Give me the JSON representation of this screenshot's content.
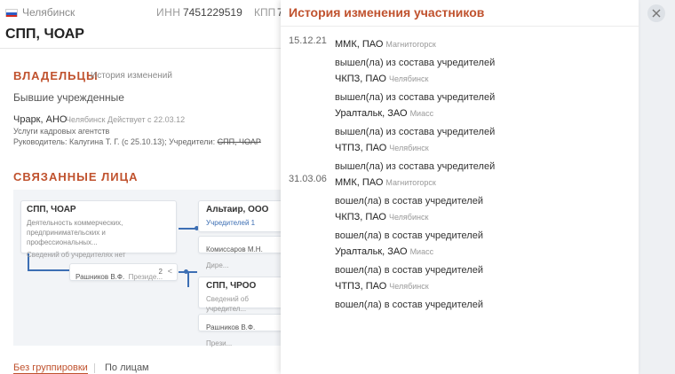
{
  "topbar": {
    "city": "Челябинск",
    "inn_label": "ИНН",
    "inn_value": "7451229519",
    "kpp_label": "КПП",
    "kpp_value": "7"
  },
  "company": {
    "title": "СПП, ЧОАР"
  },
  "owners": {
    "heading": "ВЛАДЕЛЬЦЫ",
    "history_link": "История изменений",
    "former_heading": "Бывшие учрежденные",
    "item": {
      "name": "Чрарк, АНО",
      "city": "Челябинск",
      "active": "Действует с 22.03.12",
      "activity": "Услуги кадровых агентств",
      "heads_prefix": "Руководитель: Калугина Т. Г. (с 25.10.13); Учредители:",
      "heads_strike": "СПП, ЧОАР"
    }
  },
  "related": {
    "heading": "СВЯЗАННЫЕ ЛИЦА",
    "main_node": {
      "title": "СПП, ЧОАР",
      "desc1": "Деятельность коммерческих,",
      "desc2": "предпринимательских и профессиональных...",
      "note": "Сведений об учредителях нет"
    },
    "person_node": {
      "name": "Рашников В.Ф.",
      "role": "Президе...",
      "count": "2"
    },
    "altair_node": {
      "title": "Альтаир, ООО",
      "founders": "Учредителей 1"
    },
    "kommissarov_node": {
      "name": "Комиссаров М.Н.",
      "role": "Дире..."
    },
    "sppchroo_node": {
      "title": "СПП, ЧРОО",
      "note": "Сведений об учредител..."
    },
    "rashnikov2_node": {
      "name": "Рашников В.Ф.",
      "role": "Прези..."
    }
  },
  "grouping": {
    "active_tab": "Без группировки",
    "other_tab": "По лицам"
  },
  "modal": {
    "title": "История изменения участников",
    "groups": [
      {
        "date": "15.12.21",
        "entries": [
          {
            "name": "ММК, ПАО",
            "city": "Магнитогорск",
            "action": "вышел(ла) из состава учредителей"
          },
          {
            "name": "ЧКПЗ, ПАО",
            "city": "Челябинск",
            "action": "вышел(ла) из состава учредителей"
          },
          {
            "name": "Уралтальк, ЗАО",
            "city": "Миасс",
            "action": "вышел(ла) из состава учредителей"
          },
          {
            "name": "ЧТПЗ, ПАО",
            "city": "Челябинск",
            "action": "вышел(ла) из состава учредителей"
          }
        ]
      },
      {
        "date": "31.03.06",
        "entries": [
          {
            "name": "ММК, ПАО",
            "city": "Магнитогорск",
            "action": "вошел(ла) в состав учредителей"
          },
          {
            "name": "ЧКПЗ, ПАО",
            "city": "Челябинск",
            "action": "вошел(ла) в состав учредителей"
          },
          {
            "name": "Уралтальк, ЗАО",
            "city": "Миасс",
            "action": "вошел(ла) в состав учредителей"
          },
          {
            "name": "ЧТПЗ, ПАО",
            "city": "Челябинск",
            "action": "вошел(ла) в состав учредителей"
          }
        ]
      }
    ]
  },
  "colors": {
    "accent": "#c0522e",
    "link_line": "#3d6fb4",
    "graph_bg": "#f2f4f7"
  },
  "icons": {
    "close": "close-icon",
    "share": "share-icon",
    "flag": "russia-flag-icon"
  }
}
